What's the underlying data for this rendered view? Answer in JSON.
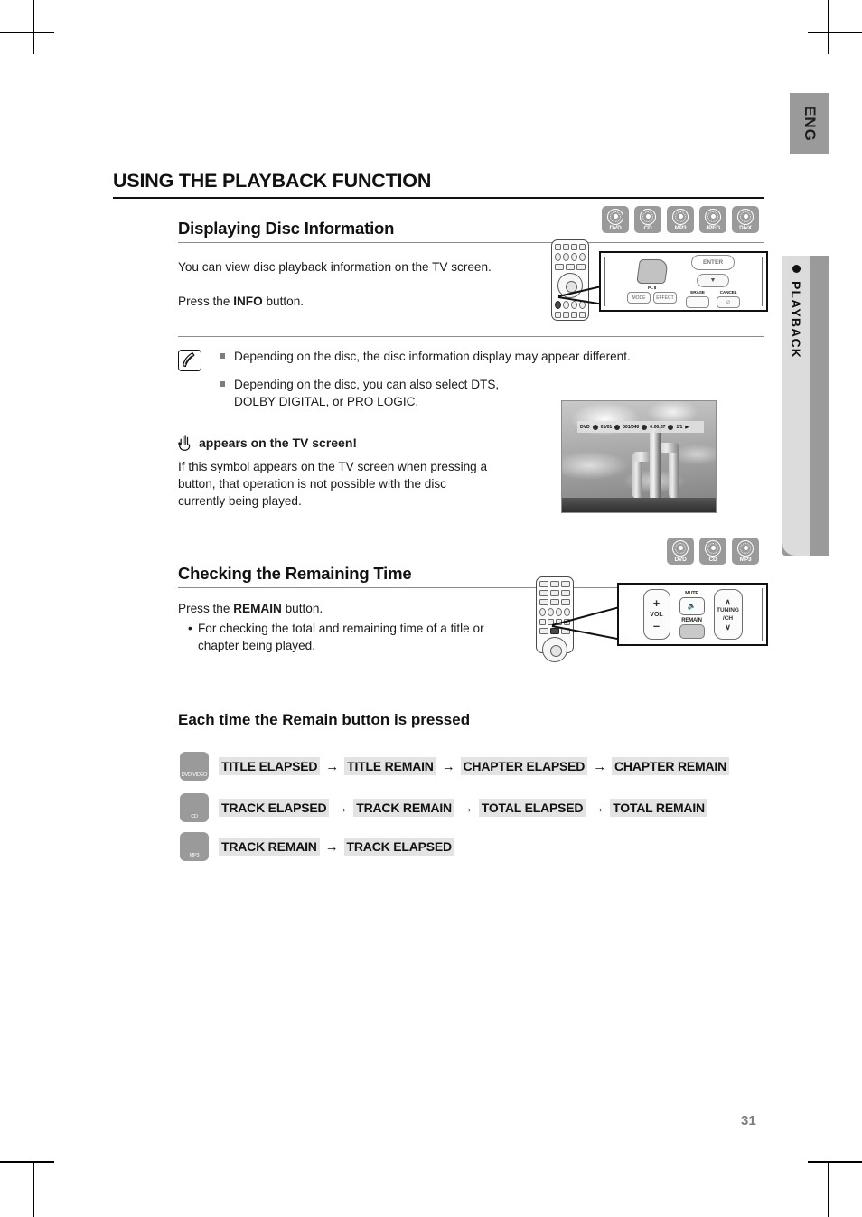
{
  "page": {
    "number": "31",
    "language_tab": "ENG",
    "side_tab_label": "PLAYBACK",
    "title": "USING THE PLAYBACK FUNCTION"
  },
  "sections": [
    {
      "heading": "Displaying Disc Information",
      "disc_icons": [
        "DVD",
        "CD",
        "MP3",
        "JPEG",
        "DivX"
      ],
      "paragraphs": [
        "You can view disc playback information  on the TV screen.",
        "Press the "
      ],
      "press_prefix": "Press the ",
      "press_bold": "INFO",
      "press_suffix": " button."
    },
    {
      "heading": "Checking the Remaining Time",
      "disc_icons": [
        "DVD",
        "CD",
        "MP3"
      ],
      "press_prefix": "Press the ",
      "press_bold": "REMAIN",
      "press_suffix": " button.",
      "bullet": "For checking the total and remaining time of a title or chapter being played."
    }
  ],
  "note": {
    "icon": "note-pencil-icon",
    "items": [
      "Depending on the disc, the disc information display may appear different.",
      "Depending on the disc, you can also select DTS, DOLBY DIGITAL, or PRO LOGIC."
    ]
  },
  "hand_notice": {
    "icon": "hand-icon",
    "title": "appears on the TV screen!",
    "body": "If this symbol appears on the TV screen when pressing a button, that operation is not possible with the disc currently being played."
  },
  "tv_screen": {
    "alt": "desert cactus still image with on-screen display bar",
    "osd": {
      "disc_type": "DVD",
      "title": "01/01",
      "chapter": "001/040",
      "time": "0:00:37",
      "audio": "1/1",
      "play_icon": "▶"
    }
  },
  "remote_callout_1": {
    "enter_label": "ENTER",
    "mode_label": "MODE",
    "effect_label": "EFFECT",
    "dolby_label": "PL Ⅱ",
    "erase_label": "ERASE",
    "cancel_label": "CANCEL",
    "info_button": "INFO"
  },
  "remote_callout_2": {
    "vol_label": "VOL",
    "vol_plus": "+",
    "vol_minus": "–",
    "mute_label": "MUTE",
    "mute_glyph": "🔇",
    "remain_label": "REMAIN",
    "tuning_label": "TUNING",
    "channel_label": "/CH",
    "up_glyph": "∧",
    "down_glyph": "∨"
  },
  "sequence": {
    "title": "Each time the Remain button is pressed",
    "arrow": "→",
    "rows": [
      {
        "disc": "DVD-VIDEO",
        "items": [
          "TITLE ELAPSED",
          "TITLE REMAIN",
          "CHAPTER ELAPSED",
          "CHAPTER REMAIN"
        ]
      },
      {
        "disc": "CD",
        "items": [
          "TRACK ELAPSED",
          "TRACK REMAIN",
          "TOTAL ELAPSED",
          "TOTAL REMAIN"
        ]
      },
      {
        "disc": "MP3",
        "items": [
          "TRACK REMAIN",
          "TRACK ELAPSED"
        ]
      }
    ]
  }
}
